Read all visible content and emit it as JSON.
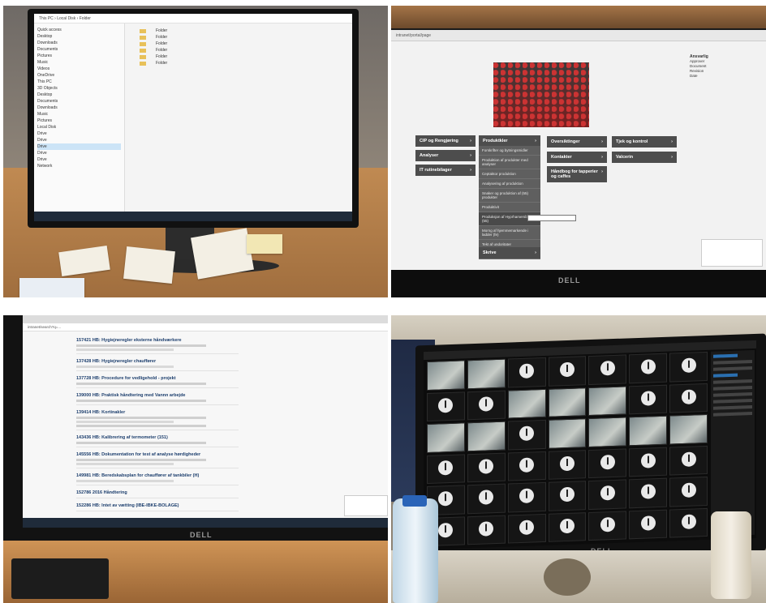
{
  "panels": [
    {
      "name": "file-explorer-monitor",
      "monitor_brand": ""
    },
    {
      "name": "intranet-portal-monitor",
      "monitor_brand": "DELL"
    },
    {
      "name": "search-results-monitor",
      "monitor_brand": "DELL"
    },
    {
      "name": "camera-surveillance-monitor",
      "monitor_brand": "DELL"
    }
  ],
  "intranet": {
    "tiles": [
      {
        "label": "CIP og Rengjøring"
      },
      {
        "label": "Analyser"
      },
      {
        "label": "IT rutinebilager"
      },
      {
        "label": "Produktkler"
      },
      {
        "label": "Oversiktinger"
      },
      {
        "label": "Kontakter"
      },
      {
        "label": "Håndbog for tapperier og caffes"
      },
      {
        "label": "Tjek og kontrol"
      },
      {
        "label": "Valcerin"
      },
      {
        "label": "Skrive"
      }
    ],
    "menu_items": [
      "Forskrifter og bytningsmidler",
      "Produktion af produkter med analyser",
      "Ceptaktor produktion",
      "Analysering af produktion",
      "Snaker og produktion af (55) produkter",
      "Produktivit",
      "Produksjon af Hyprhamersbyst (55)",
      "Morng af hjemmemarkende i ladder (fe)",
      "Tekt af undoritater",
      "Kraft"
    ]
  },
  "search_results": [
    "157421 HB: Hygiejneregler eksterne håndværkere",
    "137428 HB: Hygiejneregler chauffører",
    "137728 HB: Procedure for vedligehold - projekt",
    "139000 HB: Praktisk håndtering med Vannn arbejde",
    "139414 HB: Kortinakler",
    "143436 HB: Kalibrering af termometer (151)",
    "145556 HB: Dokumentation for test af analyse hørdigheder",
    "149981 HB: Beredskabsplan for chauffører af tankbiler (H)",
    "152786 2016 Håndtering",
    "152286 HB: Intet av vætting (IBE-IBKE-BOLAGE)"
  ],
  "camera_grid": {
    "rows": 6,
    "cols": 7,
    "live_cells": [
      0,
      1,
      9,
      10,
      11,
      14,
      15,
      17,
      18,
      19,
      20
    ]
  }
}
